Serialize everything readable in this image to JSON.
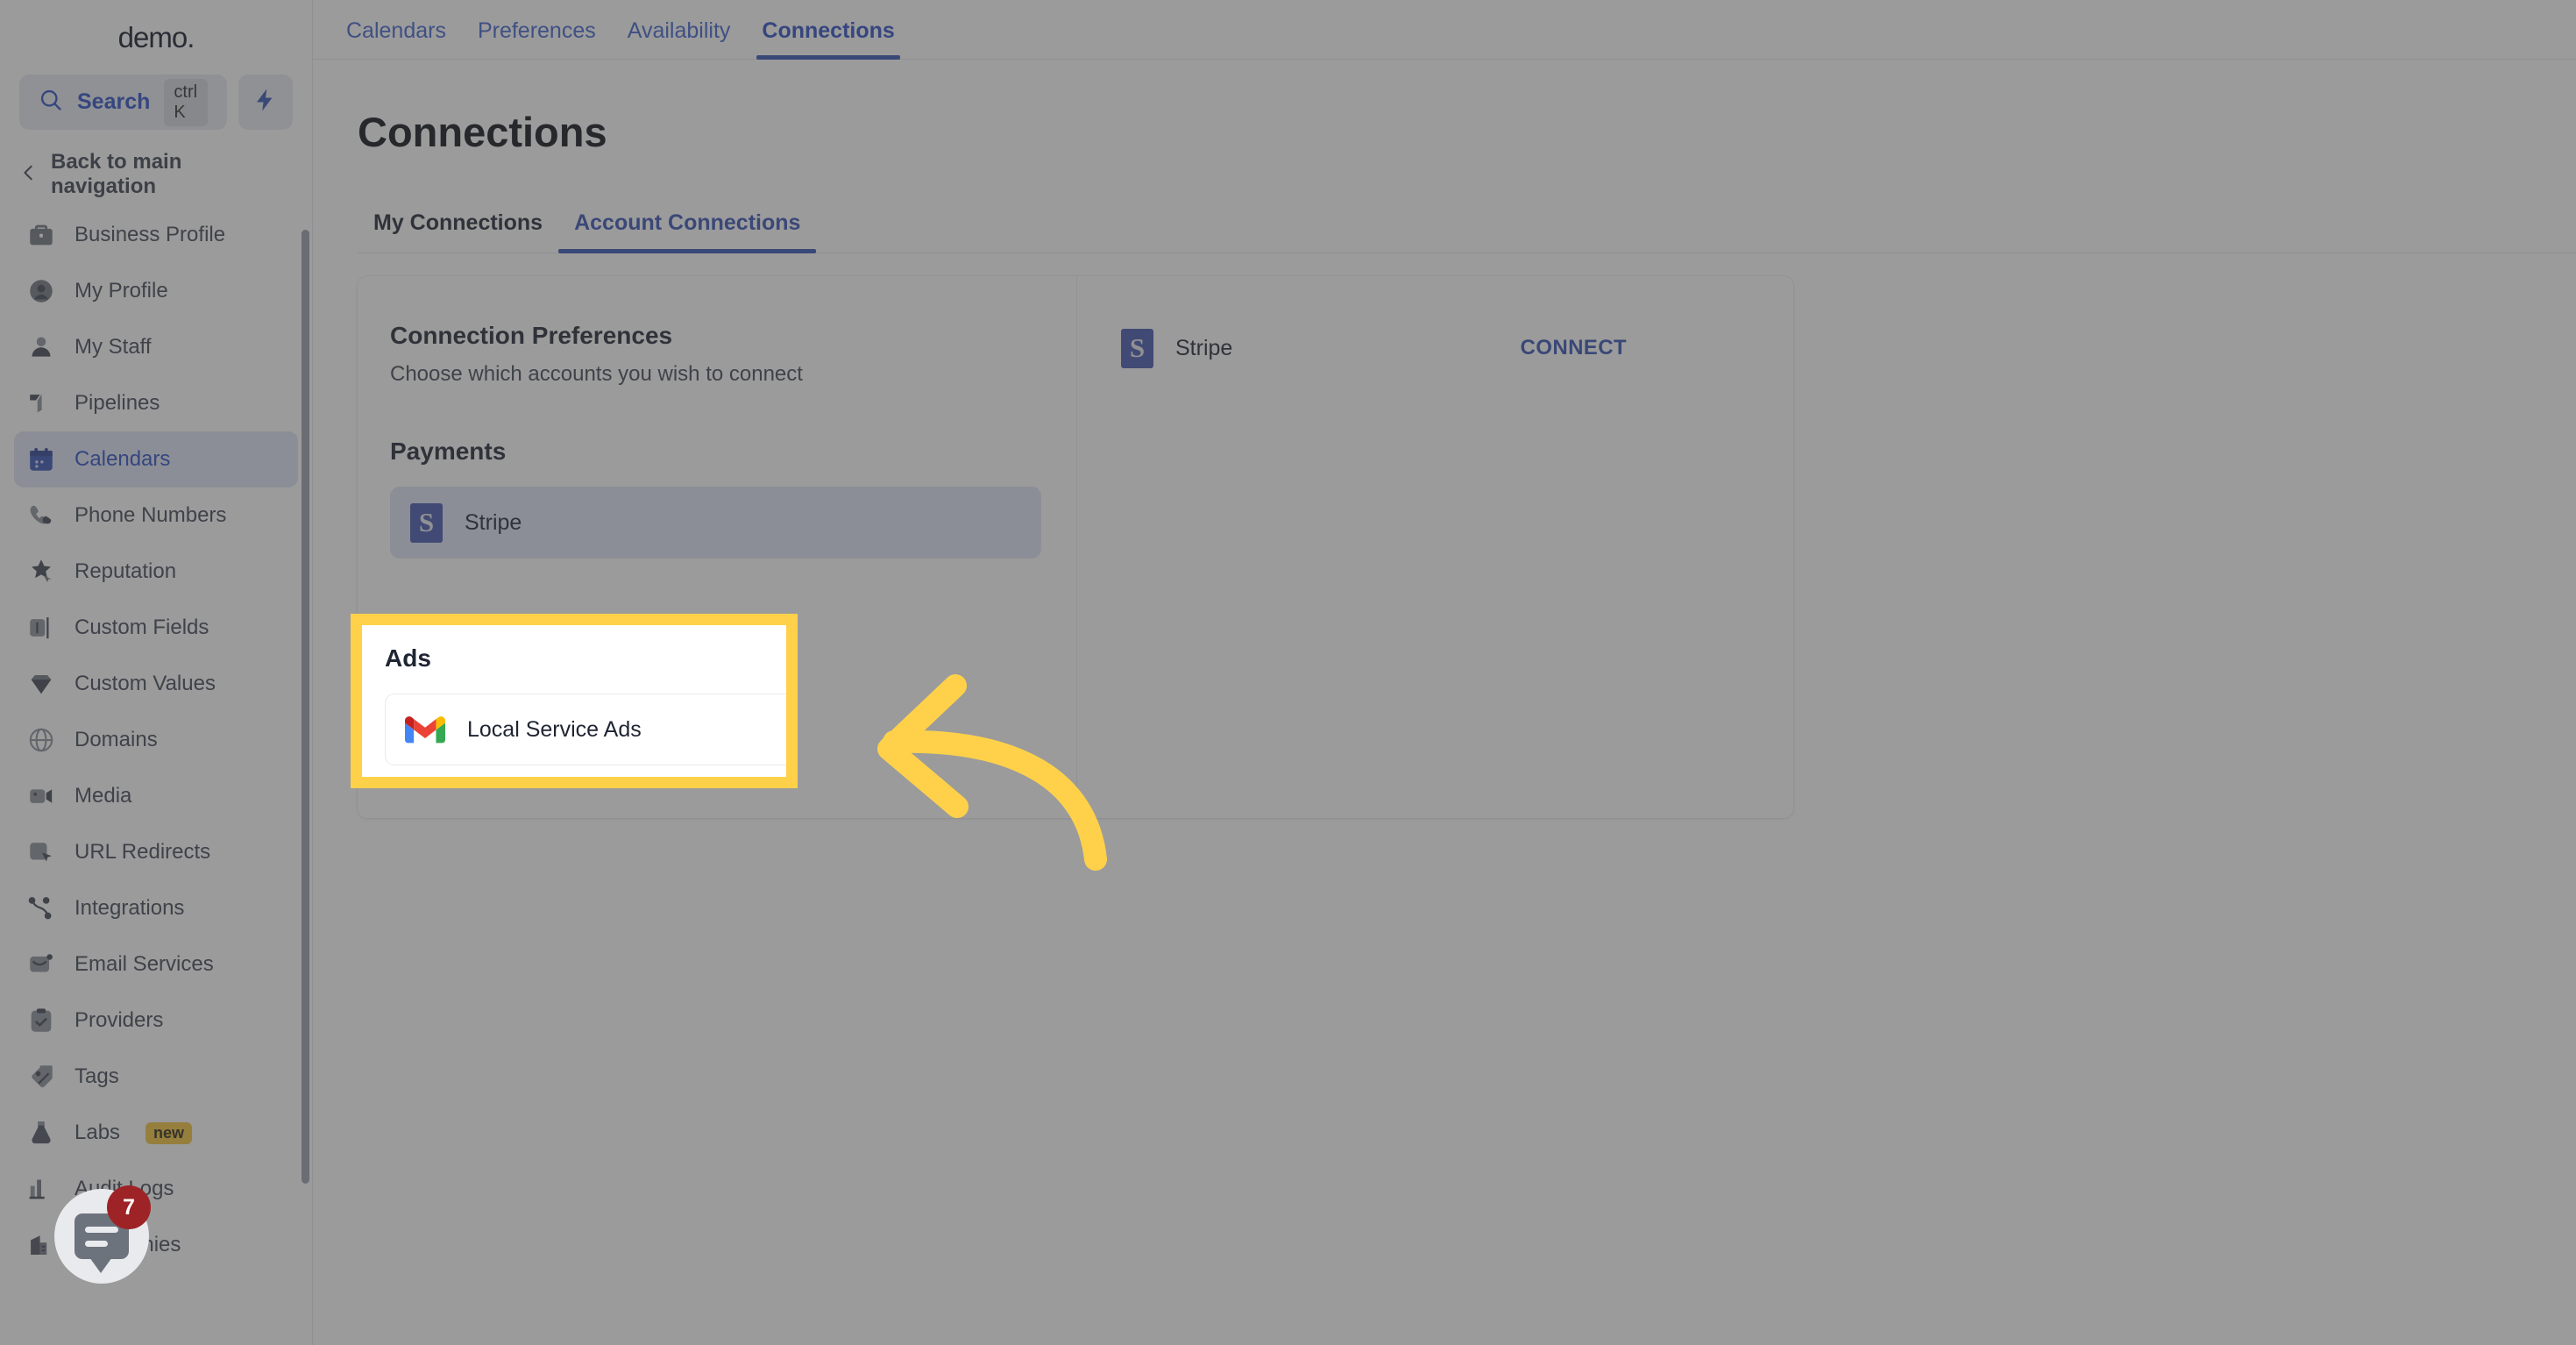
{
  "brand": {
    "name": "demo."
  },
  "sidebar": {
    "search": {
      "label": "Search",
      "shortcut": "ctrl K",
      "icon": "search-icon"
    },
    "quick_action_icon": "lightning-bolt-icon",
    "back_nav": {
      "label": "Back to main navigation",
      "icon": "chevron-left-icon"
    },
    "items": [
      {
        "label": "Business Profile",
        "icon": "briefcase-icon",
        "active": false
      },
      {
        "label": "My Profile",
        "icon": "user-circle-icon",
        "active": false
      },
      {
        "label": "My Staff",
        "icon": "user-icon",
        "active": false
      },
      {
        "label": "Pipelines",
        "icon": "funnel-icon",
        "active": false
      },
      {
        "label": "Calendars",
        "icon": "calendar-icon",
        "active": true
      },
      {
        "label": "Phone Numbers",
        "icon": "phone-icon",
        "active": false
      },
      {
        "label": "Reputation",
        "icon": "star-icon",
        "active": false
      },
      {
        "label": "Custom Fields",
        "icon": "text-field-icon",
        "active": false
      },
      {
        "label": "Custom Values",
        "icon": "gem-icon",
        "active": false
      },
      {
        "label": "Domains",
        "icon": "globe-icon",
        "active": false
      },
      {
        "label": "Media",
        "icon": "video-camera-icon",
        "active": false
      },
      {
        "label": "URL Redirects",
        "icon": "cursor-square-icon",
        "active": false
      },
      {
        "label": "Integrations",
        "icon": "nodes-icon",
        "active": false
      },
      {
        "label": "Email Services",
        "icon": "envelope-icon",
        "active": false
      },
      {
        "label": "Providers",
        "icon": "clipboard-check-icon",
        "active": false
      },
      {
        "label": "Tags",
        "icon": "tag-icon",
        "active": false
      },
      {
        "label": "Labs",
        "icon": "flask-icon",
        "badge": "new",
        "active": false
      },
      {
        "label": "Audit Logs",
        "icon": "bar-chart-icon",
        "active": false
      },
      {
        "label": "Companies",
        "icon": "building-icon",
        "active": false
      }
    ],
    "chat_widget": {
      "icon": "chat-bubble-icon",
      "unread_count": "7"
    }
  },
  "top_tabs": [
    {
      "label": "Calendars",
      "active": false
    },
    {
      "label": "Preferences",
      "active": false
    },
    {
      "label": "Availability",
      "active": false
    },
    {
      "label": "Connections",
      "active": true
    }
  ],
  "page": {
    "title": "Connections",
    "sub_tabs": [
      {
        "label": "My Connections",
        "active": false
      },
      {
        "label": "Account Connections",
        "active": true
      }
    ]
  },
  "connection_preferences": {
    "title": "Connection Preferences",
    "subtitle": "Choose which accounts you wish to connect",
    "groups": [
      {
        "title": "Payments",
        "items": [
          {
            "label": "Stripe",
            "icon": "stripe-icon",
            "selected": true
          }
        ]
      },
      {
        "title": "Ads",
        "items": [
          {
            "label": "Local Service Ads",
            "icon": "gmail-icon",
            "selected": false
          }
        ]
      }
    ]
  },
  "account_panel": {
    "rows": [
      {
        "label": "Stripe",
        "icon": "stripe-icon",
        "action_label": "CONNECT"
      }
    ]
  },
  "annotation": {
    "highlight_color": "#ffd14a",
    "arrow_color": "#ffd14a",
    "arrow_icon": "curved-arrow-left-icon",
    "target": "Ads"
  },
  "colors": {
    "accent": "#3552b5",
    "highlight": "#ffd14a",
    "badge_red": "#9d2326",
    "badge_yellow": "#f4c23c"
  }
}
